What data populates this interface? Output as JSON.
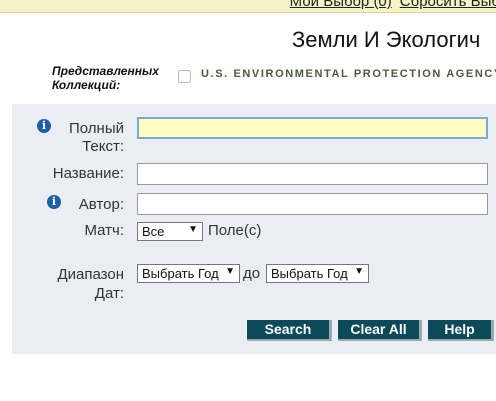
{
  "header": {
    "link_selection": "Мой Выбор (0)",
    "link_reset": "Сбросить Выб",
    "title": "Земли И Экологич"
  },
  "collections": {
    "label_line1": "Представленных",
    "label_line2": "Коллекций:",
    "item": "U.S. ENVIRONMENTAL PROTECTION AGENCY",
    "checked": false
  },
  "form": {
    "info_glyph": "i",
    "fulltext_label_line1": "Полный",
    "fulltext_label_line2": "Текст:",
    "fulltext_value": "",
    "title_label": "Название:",
    "title_value": "",
    "author_label": "Автор:",
    "author_value": "",
    "match_label": "Матч:",
    "match_selected": "Все",
    "field_suffix": "Поле(с)",
    "date_label_line1": "Диапазон",
    "date_label_line2": "Дат:",
    "date_from": "Выбрать Год",
    "date_to_word": "до",
    "date_to": "Выбрать Год",
    "dropdown_arrow": "▼"
  },
  "buttons": {
    "search": "Search",
    "clear_all": "Clear All",
    "help": "Help"
  },
  "colors": {
    "top_bar": "#f6f4c7",
    "panel": "#eaedf3",
    "button": "#0c4a5a",
    "info_icon": "#1a5fa8",
    "focused_field": "#fcfcc4"
  }
}
